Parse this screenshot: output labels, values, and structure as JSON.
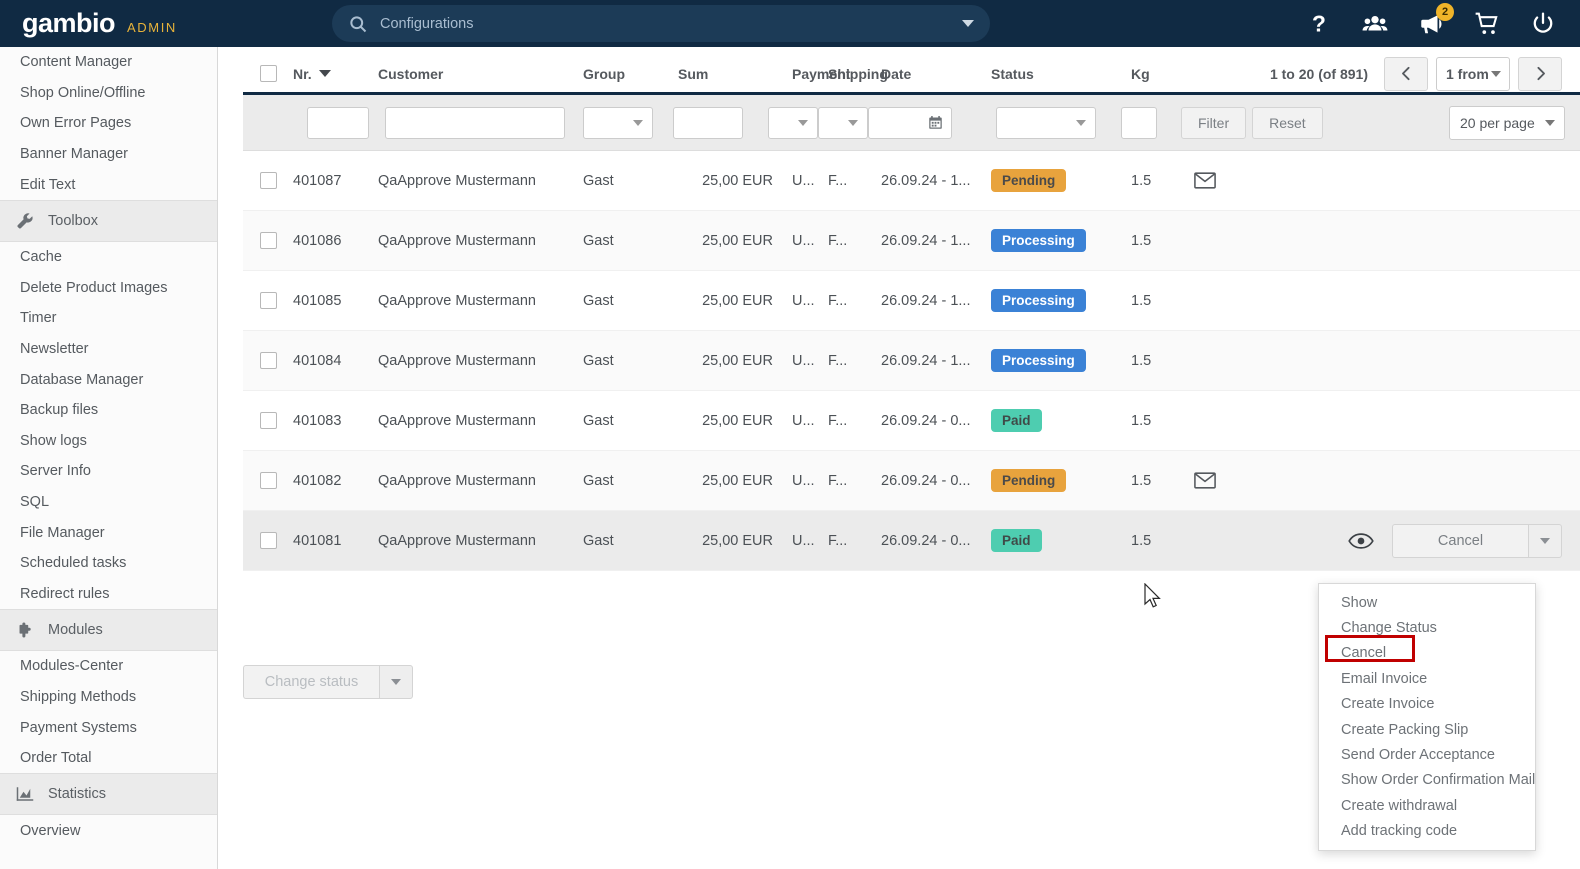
{
  "topbar": {
    "logo": "gambio",
    "logo_suffix": "ADMIN",
    "search_placeholder": "Configurations",
    "icons": [
      {
        "name": "help-icon",
        "label": "?"
      },
      {
        "name": "customers-icon",
        "label": "Customers"
      },
      {
        "name": "announcements-icon",
        "label": "Announcements",
        "badge": "2"
      },
      {
        "name": "cart-icon",
        "label": "Cart"
      },
      {
        "name": "power-icon",
        "label": "Logout"
      }
    ]
  },
  "sidebar": {
    "items": [
      {
        "type": "link",
        "label": "Content Manager"
      },
      {
        "type": "link",
        "label": "Shop Online/Offline"
      },
      {
        "type": "link",
        "label": "Own Error Pages"
      },
      {
        "type": "link",
        "label": "Banner Manager"
      },
      {
        "type": "link",
        "label": "Edit Text"
      },
      {
        "type": "section",
        "label": "Toolbox",
        "icon": "wrench-icon"
      },
      {
        "type": "link",
        "label": "Cache"
      },
      {
        "type": "link",
        "label": "Delete Product Images"
      },
      {
        "type": "link",
        "label": "Timer"
      },
      {
        "type": "link",
        "label": "Newsletter"
      },
      {
        "type": "link",
        "label": "Database Manager"
      },
      {
        "type": "link",
        "label": "Backup files"
      },
      {
        "type": "link",
        "label": "Show logs"
      },
      {
        "type": "link",
        "label": "Server Info"
      },
      {
        "type": "link",
        "label": "SQL"
      },
      {
        "type": "link",
        "label": "File Manager"
      },
      {
        "type": "link",
        "label": "Scheduled tasks"
      },
      {
        "type": "link",
        "label": "Redirect rules"
      },
      {
        "type": "section",
        "label": "Modules",
        "icon": "puzzle-icon"
      },
      {
        "type": "link",
        "label": "Modules-Center"
      },
      {
        "type": "link",
        "label": "Shipping Methods"
      },
      {
        "type": "link",
        "label": "Payment Systems"
      },
      {
        "type": "link",
        "label": "Order Total"
      },
      {
        "type": "section",
        "label": "Statistics",
        "icon": "chart-icon"
      },
      {
        "type": "link",
        "label": "Overview"
      }
    ]
  },
  "table": {
    "columns": {
      "nr": "Nr.",
      "customer": "Customer",
      "group": "Group",
      "sum": "Sum",
      "payment": "Payment",
      "shipping": "Shipping",
      "date": "Date",
      "status": "Status",
      "kg": "Kg"
    },
    "pagination": {
      "range_label": "1 to 20 (of 891)",
      "page_select": "1 from",
      "prev_icon": "chevron-left-icon",
      "next_icon": "chevron-right-icon"
    },
    "filters": {
      "nr_value": "",
      "customer_value": "",
      "group_value": "",
      "sum_value": "",
      "payment_value": "",
      "shipping_value": "",
      "date_value": "",
      "status_value": "",
      "kg_value": "",
      "filter_button": "Filter",
      "reset_button": "Reset",
      "per_page": "20 per page"
    },
    "rows": [
      {
        "nr": "401087",
        "customer": "QaApprove Mustermann",
        "group": "Gast",
        "sum": "25,00 EUR",
        "payment": "U...",
        "shipping": "F...",
        "date": "26.09.24 - 1...",
        "status": "Pending",
        "status_kind": "pending",
        "kg": "1.5",
        "mail": true
      },
      {
        "nr": "401086",
        "customer": "QaApprove Mustermann",
        "group": "Gast",
        "sum": "25,00 EUR",
        "payment": "U...",
        "shipping": "F...",
        "date": "26.09.24 - 1...",
        "status": "Processing",
        "status_kind": "processing",
        "kg": "1.5",
        "mail": false
      },
      {
        "nr": "401085",
        "customer": "QaApprove Mustermann",
        "group": "Gast",
        "sum": "25,00 EUR",
        "payment": "U...",
        "shipping": "F...",
        "date": "26.09.24 - 1...",
        "status": "Processing",
        "status_kind": "processing",
        "kg": "1.5",
        "mail": false
      },
      {
        "nr": "401084",
        "customer": "QaApprove Mustermann",
        "group": "Gast",
        "sum": "25,00 EUR",
        "payment": "U...",
        "shipping": "F...",
        "date": "26.09.24 - 1...",
        "status": "Processing",
        "status_kind": "processing",
        "kg": "1.5",
        "mail": false
      },
      {
        "nr": "401083",
        "customer": "QaApprove Mustermann",
        "group": "Gast",
        "sum": "25,00 EUR",
        "payment": "U...",
        "shipping": "F...",
        "date": "26.09.24 - 0...",
        "status": "Paid",
        "status_kind": "paid",
        "kg": "1.5",
        "mail": false
      },
      {
        "nr": "401082",
        "customer": "QaApprove Mustermann",
        "group": "Gast",
        "sum": "25,00 EUR",
        "payment": "U...",
        "shipping": "F...",
        "date": "26.09.24 - 0...",
        "status": "Pending",
        "status_kind": "pending",
        "kg": "1.5",
        "mail": true
      },
      {
        "nr": "401081",
        "customer": "QaApprove Mustermann",
        "group": "Gast",
        "sum": "25,00 EUR",
        "payment": "U...",
        "shipping": "F...",
        "date": "26.09.24 - 0...",
        "status": "Paid",
        "status_kind": "paid",
        "kg": "1.5",
        "mail": false
      }
    ]
  },
  "row_actions": {
    "cancel_button": "Cancel",
    "eye_icon": "eye-icon"
  },
  "bottom": {
    "change_status": "Change status"
  },
  "dropdown": {
    "items": [
      "Show",
      "Change Status",
      "Cancel",
      "Email Invoice",
      "Create Invoice",
      "Create Packing Slip",
      "Send Order Acceptance",
      "Show Order Confirmation Mail",
      "Create withdrawal",
      "Add tracking code"
    ],
    "highlighted": "Cancel"
  },
  "colors": {
    "topbar": "#102a43",
    "accent_gold": "#e8b33a",
    "pending": "#e8a33d",
    "processing": "#3b82d6",
    "paid": "#4ecdb0",
    "highlight_border": "#c00000"
  }
}
